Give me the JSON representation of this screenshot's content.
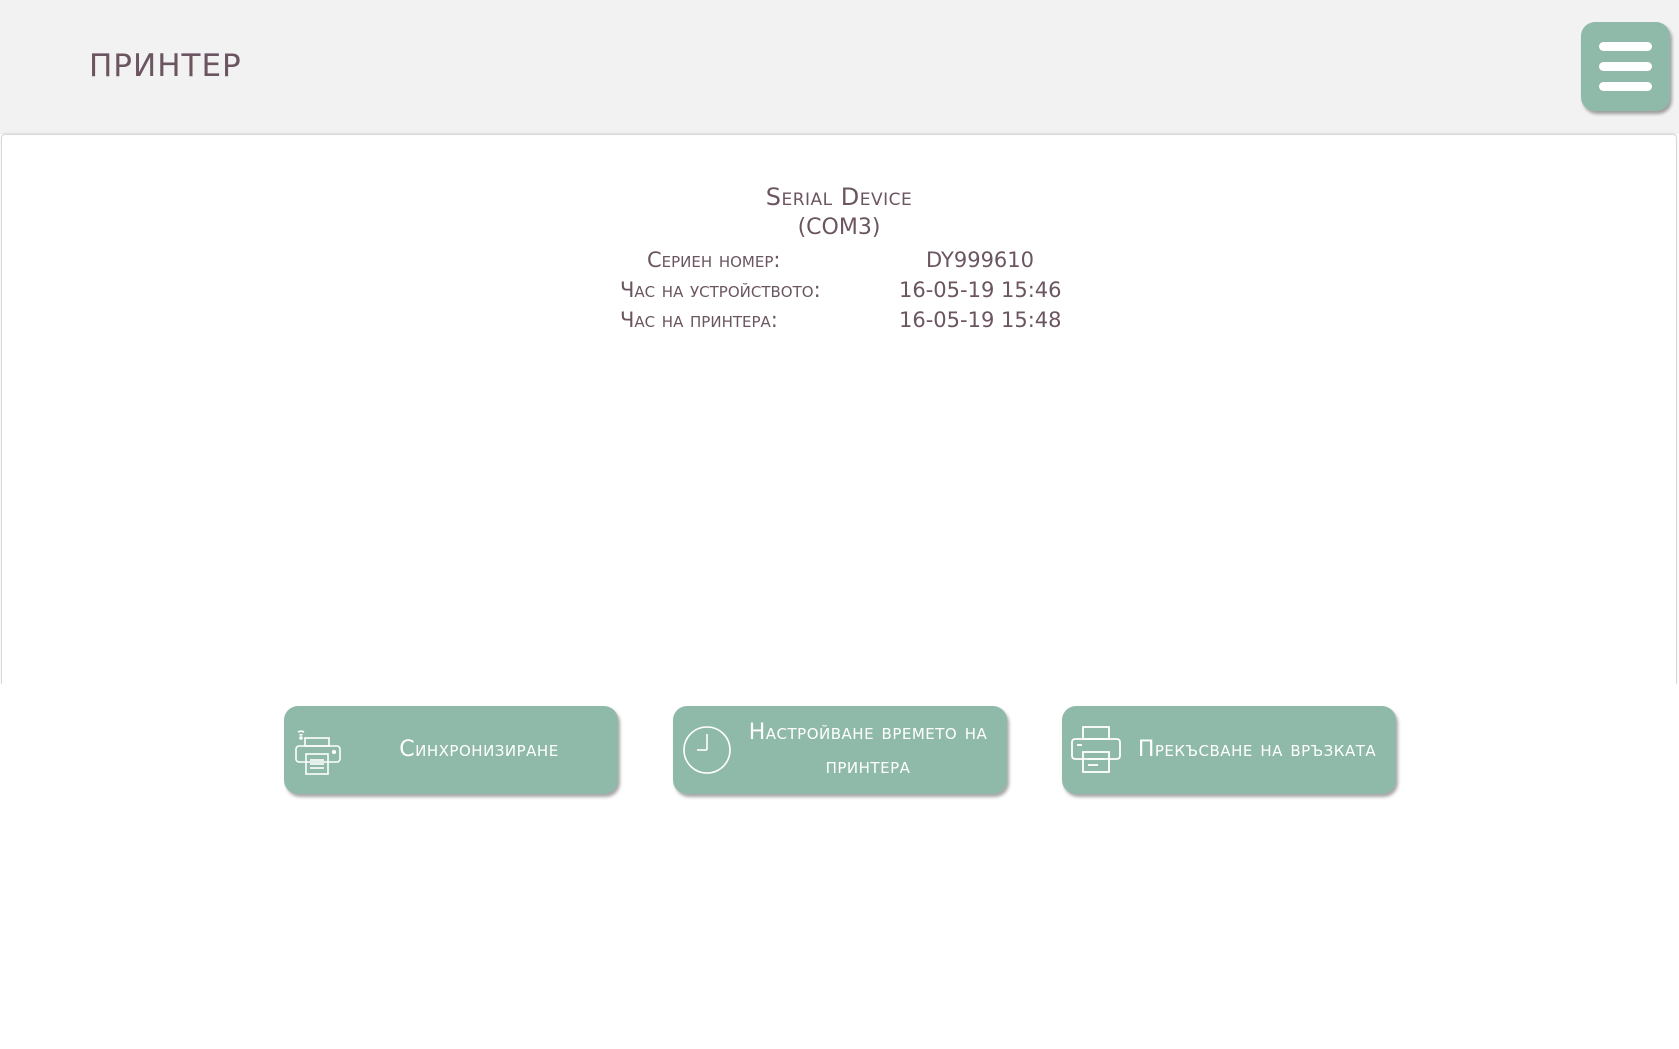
{
  "header": {
    "title": "ПРИНТЕР",
    "menu_icon": "hamburger-menu-icon"
  },
  "device": {
    "name": "Serial Device",
    "port": "(COM3)",
    "rows": [
      {
        "label": "Сериен номер:",
        "value": "DY999610"
      },
      {
        "label": "Час на устройството:",
        "value": "16-05-19 15:46"
      },
      {
        "label": "Час на принтера:",
        "value": "16-05-19 15:48"
      }
    ]
  },
  "actions": [
    {
      "label": "Синхронизиране",
      "icon": "wireless-printer-icon"
    },
    {
      "label": "Настройване времето на принтера",
      "icon": "clock-icon"
    },
    {
      "label": "Прекъсване на връзката",
      "icon": "printer-icon"
    }
  ],
  "colors": {
    "accent": "#8fbaa9",
    "text": "#6b5560",
    "header_bg": "#f2f2f2"
  }
}
